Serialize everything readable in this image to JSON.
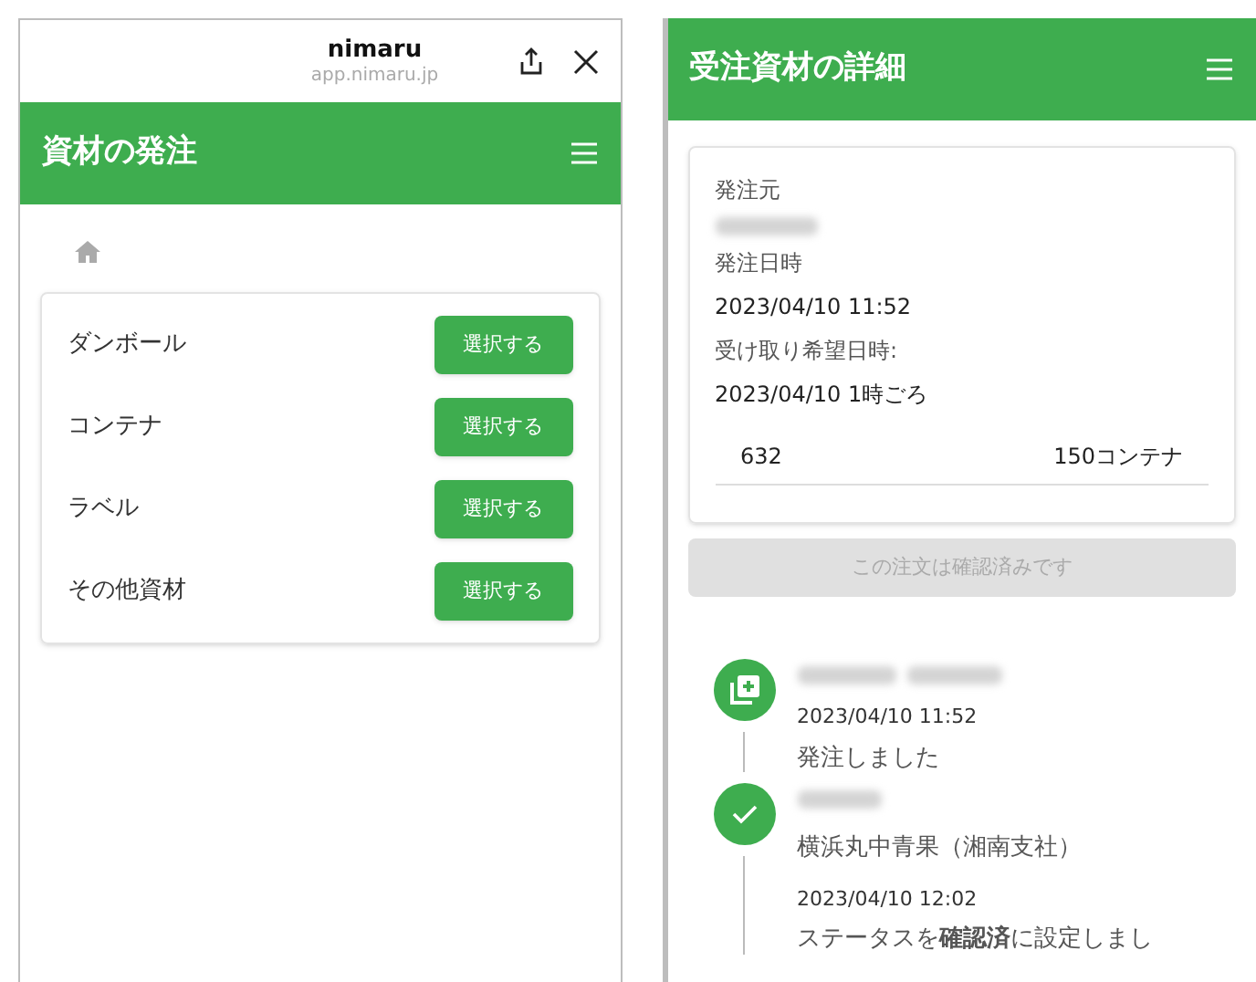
{
  "left": {
    "browser": {
      "title": "nimaru",
      "url": "app.nimaru.jp"
    },
    "header": {
      "title": "資材の発注"
    },
    "items": [
      {
        "label": "ダンボール",
        "button": "選択する"
      },
      {
        "label": "コンテナ",
        "button": "選択する"
      },
      {
        "label": "ラベル",
        "button": "選択する"
      },
      {
        "label": "その他資材",
        "button": "選択する"
      }
    ]
  },
  "right": {
    "header": {
      "title": "受注資材の詳細"
    },
    "fields": [
      {
        "label": "発注元",
        "kind": "redacted"
      },
      {
        "label": "発注日時",
        "kind": "text",
        "value": "2023/04/10 11:52"
      },
      {
        "label": "受け取り希望日時:",
        "kind": "text",
        "value": "2023/04/10 1時ごろ"
      }
    ],
    "line_item": {
      "code": "632",
      "quantity": "150コンテナ"
    },
    "confirm_button": {
      "label": "この注文は確認済みです",
      "disabled": true
    },
    "timeline": [
      {
        "kind": "created",
        "time": "2023/04/10 11:52",
        "text": "発注しました"
      },
      {
        "kind": "confirmed",
        "subtitle": "横浜丸中青果（湘南支社）",
        "time": "2023/04/10 12:02",
        "text": "ステータスを**確認済**に設定しまし"
      }
    ]
  }
}
